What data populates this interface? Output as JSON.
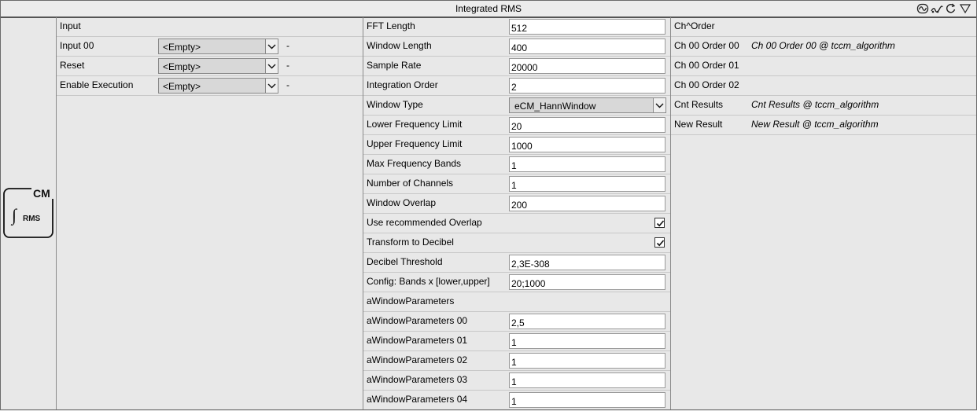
{
  "window": {
    "title": "Integrated RMS"
  },
  "toolbar": {
    "icons": [
      "signal-icon",
      "wave-icon",
      "refresh-icon",
      "dropdown-triangle-icon"
    ]
  },
  "block": {
    "icon_top": "CM",
    "icon_bottom": "RMS"
  },
  "inputs": {
    "header": "Input",
    "rows": [
      {
        "label": "Input 00",
        "value": "<Empty>",
        "extra": "-"
      },
      {
        "label": "Reset",
        "value": "<Empty>",
        "extra": "-"
      },
      {
        "label": "Enable Execution",
        "value": "<Empty>",
        "extra": "-"
      }
    ]
  },
  "params": {
    "fft_length": {
      "label": "FFT Length",
      "value": "512"
    },
    "window_length": {
      "label": "Window Length",
      "value": "400"
    },
    "sample_rate": {
      "label": "Sample Rate",
      "value": "20000"
    },
    "integration_order": {
      "label": "Integration Order",
      "value": "2"
    },
    "window_type": {
      "label": "Window Type",
      "value": "eCM_HannWindow"
    },
    "lower_freq": {
      "label": "Lower Frequency Limit",
      "value": "20"
    },
    "upper_freq": {
      "label": "Upper Frequency Limit",
      "value": "1000"
    },
    "max_bands": {
      "label": "Max Frequency Bands",
      "value": "1"
    },
    "num_channels": {
      "label": "Number of Channels",
      "value": "1"
    },
    "window_overlap": {
      "label": "Window Overlap",
      "value": "200"
    },
    "use_recommended_overlap": {
      "label": "Use recommended Overlap",
      "checked": true
    },
    "transform_db": {
      "label": "Transform to Decibel",
      "checked": true
    },
    "db_threshold": {
      "label": "Decibel Threshold",
      "value": "2,3E-308"
    },
    "config_bands": {
      "label": "Config: Bands x [lower,upper]",
      "value": "20;1000"
    },
    "window_params_header": "aWindowParameters",
    "window_params": [
      {
        "label": "aWindowParameters 00",
        "value": "2,5"
      },
      {
        "label": "aWindowParameters 01",
        "value": "1"
      },
      {
        "label": "aWindowParameters 02",
        "value": "1"
      },
      {
        "label": "aWindowParameters 03",
        "value": "1"
      },
      {
        "label": "aWindowParameters 04",
        "value": "1"
      }
    ]
  },
  "outputs": {
    "header": "Ch^Order",
    "rows": [
      {
        "label": "Ch 00 Order 00",
        "value": "Ch 00 Order 00 @ tccm_algorithm"
      },
      {
        "label": "Ch 00 Order 01",
        "value": ""
      },
      {
        "label": "Ch 00 Order 02",
        "value": ""
      },
      {
        "label": "Cnt Results",
        "value": "Cnt Results @ tccm_algorithm"
      },
      {
        "label": "New Result",
        "value": "New Result @ tccm_algorithm"
      }
    ]
  }
}
